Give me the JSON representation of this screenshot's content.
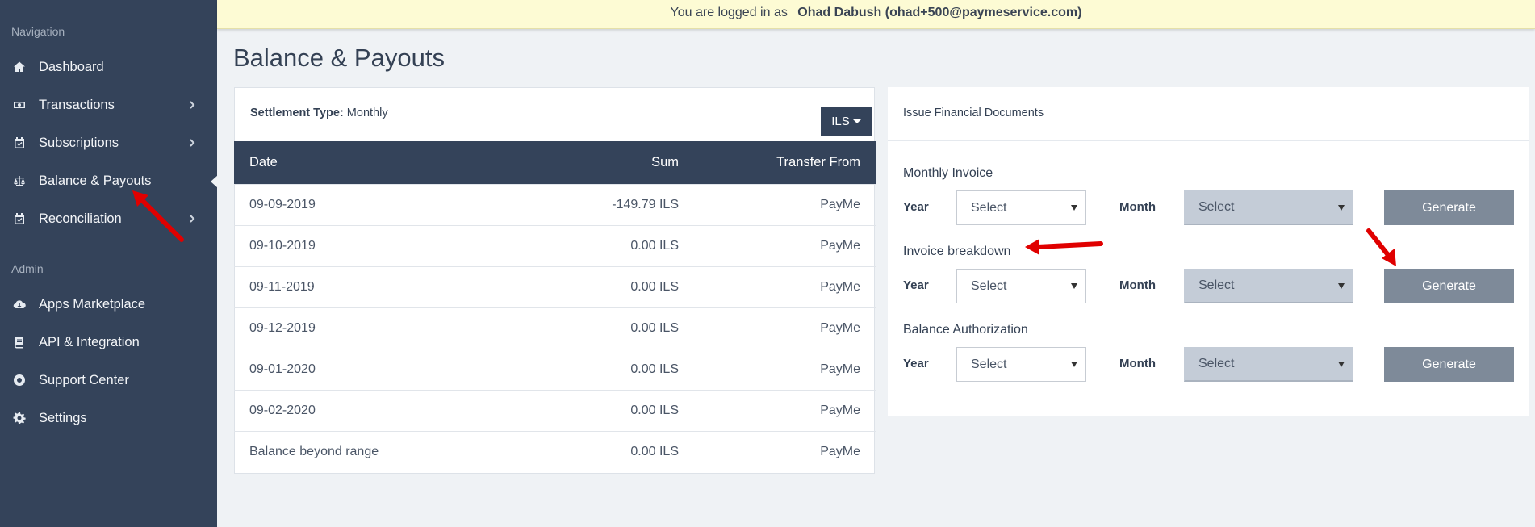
{
  "banner": {
    "prefix": "You are logged in as",
    "user": "Ohad  Dabush  (ohad+500@paymeservice.com)"
  },
  "sidebar": {
    "nav_heading": "Navigation",
    "admin_heading": "Admin",
    "items": [
      {
        "label": "Dashboard",
        "icon": "home-icon"
      },
      {
        "label": "Transactions",
        "icon": "money-icon"
      },
      {
        "label": "Subscriptions",
        "icon": "calendar-check-icon"
      },
      {
        "label": "Balance & Payouts",
        "icon": "scale-icon"
      },
      {
        "label": "Reconciliation",
        "icon": "calendar-check-icon"
      },
      {
        "label": "Apps Marketplace",
        "icon": "cloud-download-icon"
      },
      {
        "label": "API & Integration",
        "icon": "book-icon"
      },
      {
        "label": "Support Center",
        "icon": "lifebuoy-icon"
      },
      {
        "label": "Settings",
        "icon": "gear-icon"
      }
    ]
  },
  "page": {
    "title": "Balance & Payouts"
  },
  "settlement": {
    "label": "Settlement Type:",
    "value": "Monthly",
    "currency": "ILS"
  },
  "table": {
    "headers": {
      "date": "Date",
      "sum": "Sum",
      "from": "Transfer From"
    },
    "rows": [
      {
        "date": "09-09-2019",
        "sum": "-149.79 ILS",
        "from": "PayMe"
      },
      {
        "date": "09-10-2019",
        "sum": "0.00 ILS",
        "from": "PayMe"
      },
      {
        "date": "09-11-2019",
        "sum": "0.00 ILS",
        "from": "PayMe"
      },
      {
        "date": "09-12-2019",
        "sum": "0.00 ILS",
        "from": "PayMe"
      },
      {
        "date": "09-01-2020",
        "sum": "0.00 ILS",
        "from": "PayMe"
      },
      {
        "date": "09-02-2020",
        "sum": "0.00 ILS",
        "from": "PayMe"
      },
      {
        "date": "Balance beyond range",
        "sum": "0.00 ILS",
        "from": "PayMe"
      }
    ]
  },
  "documents": {
    "title": "Issue Financial Documents",
    "sections": [
      {
        "title": "Monthly Invoice",
        "year_label": "Year",
        "year_value": "Select",
        "month_label": "Month",
        "month_value": "Select",
        "button": "Generate"
      },
      {
        "title": "Invoice breakdown",
        "year_label": "Year",
        "year_value": "Select",
        "month_label": "Month",
        "month_value": "Select",
        "button": "Generate"
      },
      {
        "title": "Balance Authorization",
        "year_label": "Year",
        "year_value": "Select",
        "month_label": "Month",
        "month_value": "Select",
        "button": "Generate"
      }
    ]
  },
  "colors": {
    "sidebar": "#34435a",
    "banner": "#fdfbd4",
    "generate_button": "#7e8a99",
    "annotation_arrow": "#e00000"
  }
}
